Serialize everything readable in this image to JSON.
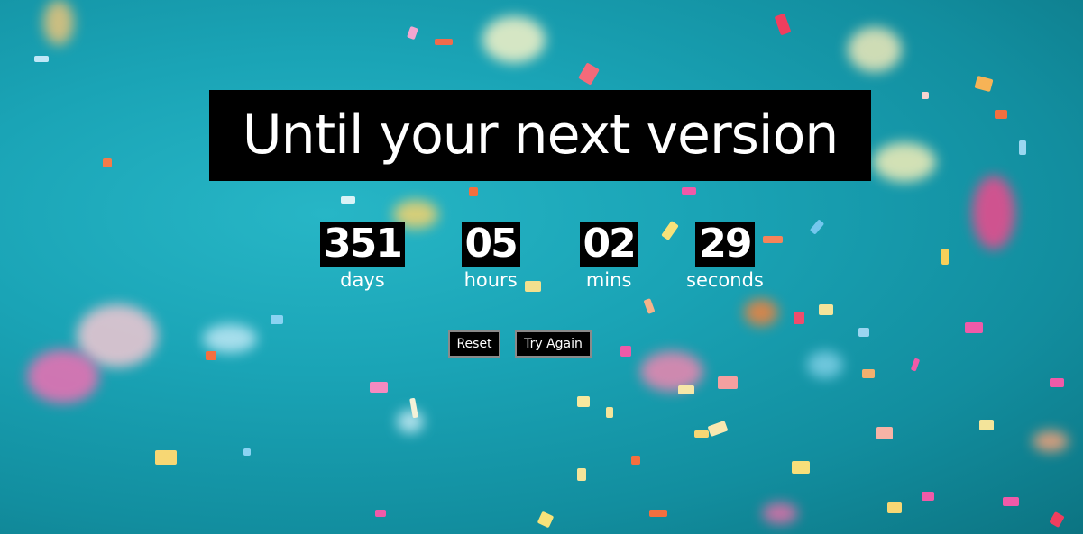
{
  "title": "Until your next version",
  "countdown": [
    {
      "value": "351",
      "unit": "days"
    },
    {
      "value": "05",
      "unit": "hours"
    },
    {
      "value": "02",
      "unit": "mins"
    },
    {
      "value": "29",
      "unit": "seconds"
    }
  ],
  "buttons": {
    "reset_label": "Reset",
    "try_again_label": "Try Again"
  },
  "colors": {
    "background": "#1aa4b6",
    "title_bg": "#000000",
    "text": "#ffffff"
  }
}
